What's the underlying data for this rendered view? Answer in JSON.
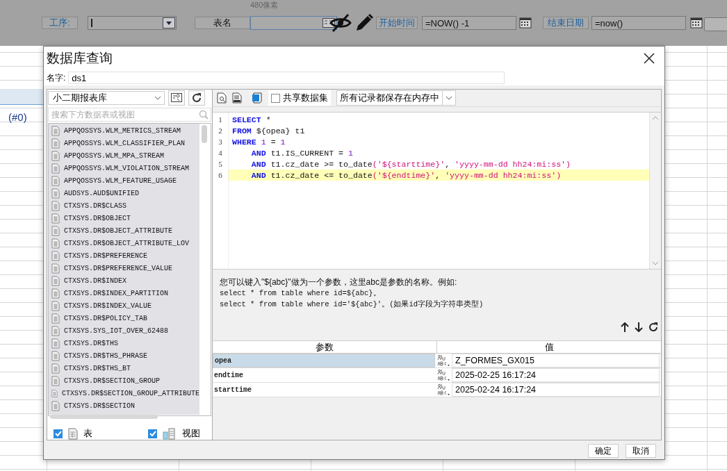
{
  "toolbar": {
    "process_label": "工序:",
    "table_label": "表名",
    "size_hint": "480像素",
    "start_label": "开始时间",
    "start_value": "=NOW() -1",
    "end_label": "结束日期",
    "end_value": "=now()"
  },
  "background": {
    "cell_text": "(#0)"
  },
  "dialog": {
    "title": "数据库查询",
    "name_label": "名字:",
    "name_value": "ds1",
    "database": "小二期报表库",
    "search_placeholder": "搜索下方数据表或视图",
    "tables": [
      "APPQOSSYS.WLM_METRICS_STREAM",
      "APPQOSSYS.WLM_CLASSIFIER_PLAN",
      "APPQOSSYS.WLM_MPA_STREAM",
      "APPQOSSYS.WLM_VIOLATION_STREAM",
      "APPQOSSYS.WLM_FEATURE_USAGE",
      "AUDSYS.AUD$UNIFIED",
      "CTXSYS.DR$CLASS",
      "CTXSYS.DR$OBJECT",
      "CTXSYS.DR$OBJECT_ATTRIBUTE",
      "CTXSYS.DR$OBJECT_ATTRIBUTE_LOV",
      "CTXSYS.DR$PREFERENCE",
      "CTXSYS.DR$PREFERENCE_VALUE",
      "CTXSYS.DR$INDEX",
      "CTXSYS.DR$INDEX_PARTITION",
      "CTXSYS.DR$INDEX_VALUE",
      "CTXSYS.DR$POLICY_TAB",
      "CTXSYS.SYS_IOT_OVER_62488",
      "CTXSYS.DR$THS",
      "CTXSYS.DR$THS_PHRASE",
      "CTXSYS.DR$THS_BT",
      "CTXSYS.DR$SECTION_GROUP",
      "CTXSYS.DR$SECTION_GROUP_ATTRIBUTE",
      "CTXSYS.DR$SECTION"
    ],
    "filters": [
      {
        "kind": "table",
        "label": "表",
        "checked": true
      },
      {
        "kind": "view",
        "label": "视图",
        "checked": true
      }
    ],
    "share_dataset": {
      "label": "共享数据集",
      "checked": false
    },
    "cache_mode": "所有记录都保存在内存中",
    "code": [
      {
        "number": "1",
        "highlighted": false,
        "tokens": [
          {
            "kind": "keyword",
            "text": "SELECT"
          },
          {
            "kind": "plain",
            "text": " *"
          }
        ]
      },
      {
        "number": "2",
        "highlighted": false,
        "tokens": [
          {
            "kind": "keyword",
            "text": "FROM"
          },
          {
            "kind": "plain",
            "text": " ${opea} t1"
          }
        ]
      },
      {
        "number": "3",
        "highlighted": false,
        "tokens": [
          {
            "kind": "keyword",
            "text": "WHERE"
          },
          {
            "kind": "number",
            "text": " 1"
          },
          {
            "kind": "plain",
            "text": " = "
          },
          {
            "kind": "number",
            "text": "1"
          }
        ]
      },
      {
        "number": "4",
        "highlighted": false,
        "tokens": [
          {
            "kind": "keyword",
            "text": "    AND"
          },
          {
            "kind": "plain",
            "text": " t1.IS_CURRENT = "
          },
          {
            "kind": "number",
            "text": "1"
          }
        ]
      },
      {
        "number": "5",
        "highlighted": false,
        "tokens": [
          {
            "kind": "keyword",
            "text": "    AND"
          },
          {
            "kind": "plain",
            "text": " t1.cz_date >= to_date"
          },
          {
            "kind": "string",
            "text": "('${starttime}'"
          },
          {
            "kind": "plain",
            "text": ", "
          },
          {
            "kind": "string",
            "text": "'yyyy-mm-dd hh24:mi:ss')"
          }
        ]
      },
      {
        "number": "6",
        "highlighted": true,
        "tokens": [
          {
            "kind": "keyword",
            "text": "    AND"
          },
          {
            "kind": "plain",
            "text": " t1.cz_date <= to_date"
          },
          {
            "kind": "string",
            "text": "('${endtime}'"
          },
          {
            "kind": "plain",
            "text": ", "
          },
          {
            "kind": "string",
            "text": "'yyyy-mm-dd hh24:mi:ss')"
          }
        ]
      }
    ],
    "help": [
      "您可以键入\"${abc}\"做为一个参数，这里abc是参数的名称。例如:",
      "select * from table where id=${abc}。",
      "select * from table where id='${abc}'。(如果id字段为字符串类型)"
    ],
    "params": {
      "columns": [
        "参数",
        "值"
      ],
      "rows": [
        {
          "name": "opea",
          "value": "Z_FORMES_GX015",
          "selected": true
        },
        {
          "name": "endtime",
          "value": "2025-02-25 16:17:24",
          "selected": false
        },
        {
          "name": "starttime",
          "value": "2025-02-24 16:17:24",
          "selected": false
        }
      ]
    },
    "buttons": [
      "确定",
      "取消"
    ]
  }
}
